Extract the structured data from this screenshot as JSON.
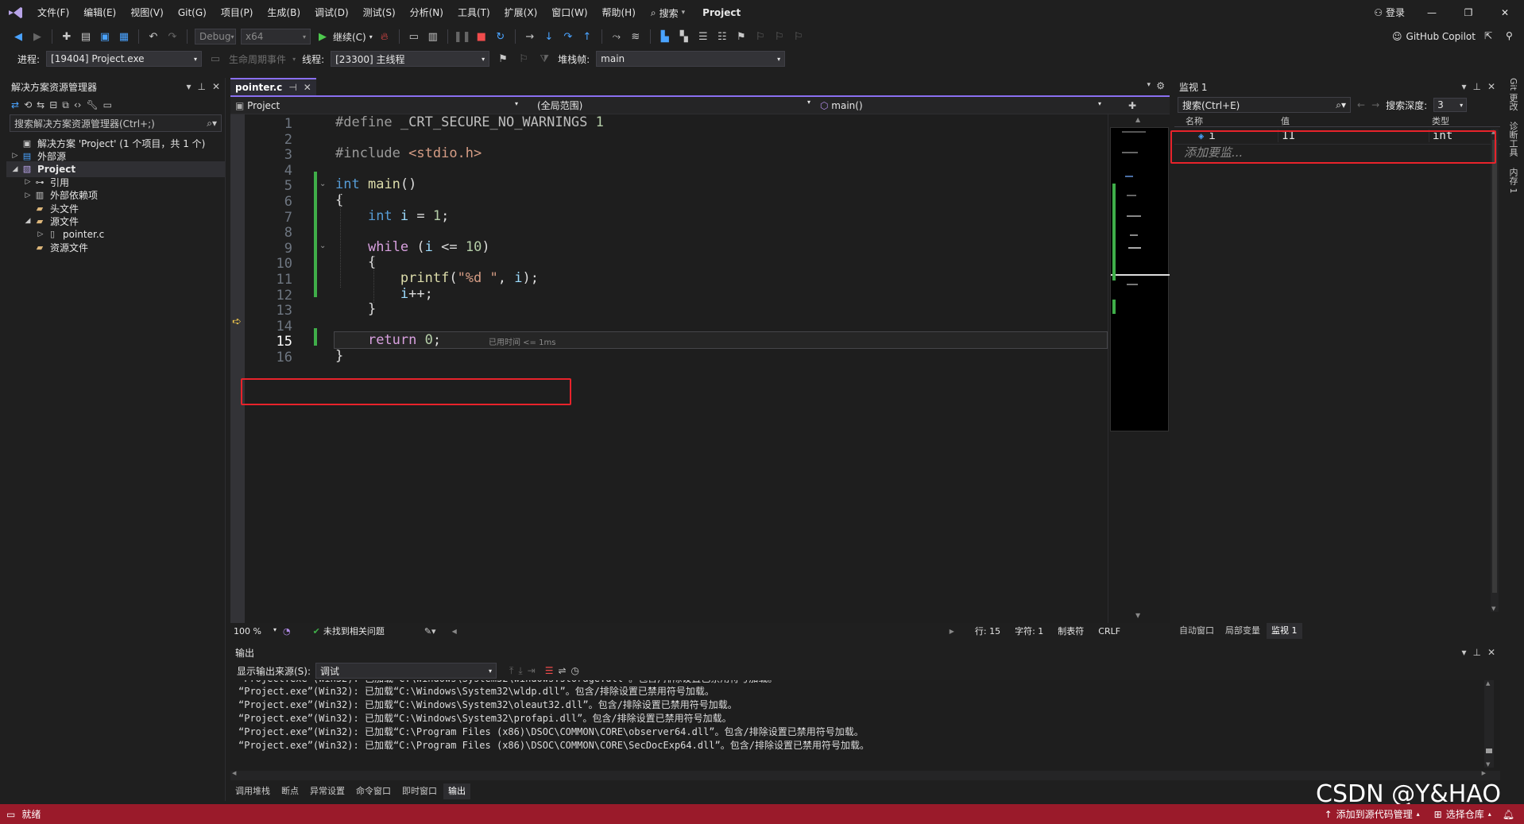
{
  "menu": {
    "items": [
      "文件(F)",
      "编辑(E)",
      "视图(V)",
      "Git(G)",
      "项目(P)",
      "生成(B)",
      "调试(D)",
      "测试(S)",
      "分析(N)",
      "工具(T)",
      "扩展(X)",
      "窗口(W)",
      "帮助(H)"
    ],
    "search_label": "搜索",
    "project_title": "Project",
    "login": "登录"
  },
  "toolbar": {
    "config": "Debug",
    "platform": "x64",
    "continue_label": "继续(C)",
    "copilot": "GitHub Copilot"
  },
  "debug_bar": {
    "process_label": "进程:",
    "process_value": "[19404] Project.exe",
    "lifecycle_label": "生命周期事件",
    "thread_label": "线程:",
    "thread_value": "[23300] 主线程",
    "stack_label": "堆栈帧:",
    "stack_value": "main"
  },
  "solution_explorer": {
    "title": "解决方案资源管理器",
    "search_placeholder": "搜索解决方案资源管理器(Ctrl+;)",
    "items": [
      {
        "label": "解决方案 'Project' (1 个项目，共 1 个)",
        "depth": 0,
        "arrow": "",
        "icon": "solution-icon"
      },
      {
        "label": "外部源",
        "depth": 0,
        "arrow": "▷",
        "icon": "external-sources-icon"
      },
      {
        "label": "Project",
        "depth": 0,
        "arrow": "◢",
        "icon": "project-icon",
        "bold": true
      },
      {
        "label": "引用",
        "depth": 1,
        "arrow": "▷",
        "icon": "references-icon"
      },
      {
        "label": "外部依赖项",
        "depth": 1,
        "arrow": "▷",
        "icon": "dependencies-icon"
      },
      {
        "label": "头文件",
        "depth": 1,
        "arrow": "",
        "icon": "folder-icon"
      },
      {
        "label": "源文件",
        "depth": 1,
        "arrow": "◢",
        "icon": "folder-icon"
      },
      {
        "label": "pointer.c",
        "depth": 2,
        "arrow": "▷",
        "icon": "c-file-icon"
      },
      {
        "label": "资源文件",
        "depth": 1,
        "arrow": "",
        "icon": "folder-icon"
      }
    ]
  },
  "editor": {
    "tab_name": "pointer.c",
    "nav_project": "Project",
    "nav_scope": "(全局范围)",
    "nav_function": "main()",
    "line_numbers": [
      "1",
      "2",
      "3",
      "4",
      "5",
      "6",
      "7",
      "8",
      "9",
      "10",
      "11",
      "12",
      "13",
      "14",
      "15",
      "16"
    ],
    "lines": [
      "#define _CRT_SECURE_NO_WARNINGS 1",
      "",
      "#include <stdio.h>",
      "",
      "int main()",
      "{",
      "    int i = 1;",
      "",
      "    while (i <= 10)",
      "    {",
      "        printf(\"%d \", i);",
      "        i++;",
      "    }",
      "",
      "    return 0;",
      "}"
    ],
    "elapsed_hint": "已用时间 <= 1ms",
    "current_line": "15"
  },
  "editor_status": {
    "zoom": "100 %",
    "issues": "未找到相关问题",
    "line": "行: 15",
    "char": "字符: 1",
    "tabs": "制表符",
    "eol": "CRLF"
  },
  "watch": {
    "title": "监视 1",
    "search_placeholder": "搜索(Ctrl+E)",
    "depth_label": "搜索深度:",
    "depth_value": "3",
    "col_name": "名称",
    "col_value": "值",
    "col_type": "类型",
    "rows": [
      {
        "name": "i",
        "value": "11",
        "type": "int"
      }
    ],
    "add_placeholder": "添加要监...",
    "tabs": [
      "自动窗口",
      "局部变量",
      "监视 1"
    ]
  },
  "output": {
    "title": "输出",
    "source_label": "显示输出来源(S):",
    "source_value": "调试",
    "lines": [
      "“Project.exe”(Win32): 已加载“C:\\Windows\\System32\\wldp.dll”。包含/排除设置已禁用符号加载。",
      "“Project.exe”(Win32): 已加载“C:\\Windows\\System32\\oleaut32.dll”。包含/排除设置已禁用符号加载。",
      "“Project.exe”(Win32): 已加载“C:\\Windows\\System32\\profapi.dll”。包含/排除设置已禁用符号加载。",
      "“Project.exe”(Win32): 已加载“C:\\Program Files (x86)\\DSOC\\COMMON\\CORE\\observer64.dll”。包含/排除设置已禁用符号加载。",
      "“Project.exe”(Win32): 已加载“C:\\Program Files (x86)\\DSOC\\COMMON\\CORE\\SecDocExp64.dll”。包含/排除设置已禁用符号加载。"
    ],
    "tabs": [
      "调用堆栈",
      "断点",
      "异常设置",
      "命令窗口",
      "即时窗口",
      "输出"
    ]
  },
  "right_strip": [
    "Git 更改",
    "诊断工具",
    "内存 1"
  ],
  "statusbar": {
    "ready": "就绪",
    "add_source": "添加到源代码管理",
    "select_repo": "选择仓库",
    "accent": "#9a1a2a"
  },
  "watermark": "CSDN @Y&HAO"
}
